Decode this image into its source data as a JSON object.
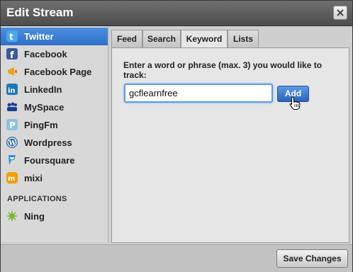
{
  "window": {
    "title": "Edit Stream"
  },
  "sidebar": {
    "items": [
      {
        "label": "Twitter",
        "icon": "twitter-icon",
        "color": "#4aa7e8",
        "active": true
      },
      {
        "label": "Facebook",
        "icon": "facebook-icon",
        "color": "#3b5998"
      },
      {
        "label": "Facebook Page",
        "icon": "facebook-page-icon",
        "color": "#f0a020"
      },
      {
        "label": "LinkedIn",
        "icon": "linkedin-icon",
        "color": "#1a7ab8"
      },
      {
        "label": "MySpace",
        "icon": "myspace-icon",
        "color": "#1d3f8f"
      },
      {
        "label": "PingFm",
        "icon": "pingfm-icon",
        "color": "#5fa0d0"
      },
      {
        "label": "Wordpress",
        "icon": "wordpress-icon",
        "color": "#2f6fa6"
      },
      {
        "label": "Foursquare",
        "icon": "foursquare-icon",
        "color": "#2c8fd6"
      },
      {
        "label": "mixi",
        "icon": "mixi-icon",
        "color": "#f0a000"
      }
    ],
    "apps_header": "APPLICATIONS",
    "apps": [
      {
        "label": "Ning",
        "icon": "ning-icon",
        "color": "#7ab830"
      }
    ]
  },
  "tabs": [
    {
      "label": "Feed"
    },
    {
      "label": "Search"
    },
    {
      "label": "Keyword",
      "active": true
    },
    {
      "label": "Lists"
    }
  ],
  "keyword": {
    "prompt": "Enter a word or phrase (max. 3) you would like to track:",
    "input_value": "gcflearnfree",
    "add_label": "Add"
  },
  "footer": {
    "save_label": "Save Changes"
  },
  "colors": {
    "accent": "#3a7bd5",
    "titlebar": "#5a5a5a"
  }
}
